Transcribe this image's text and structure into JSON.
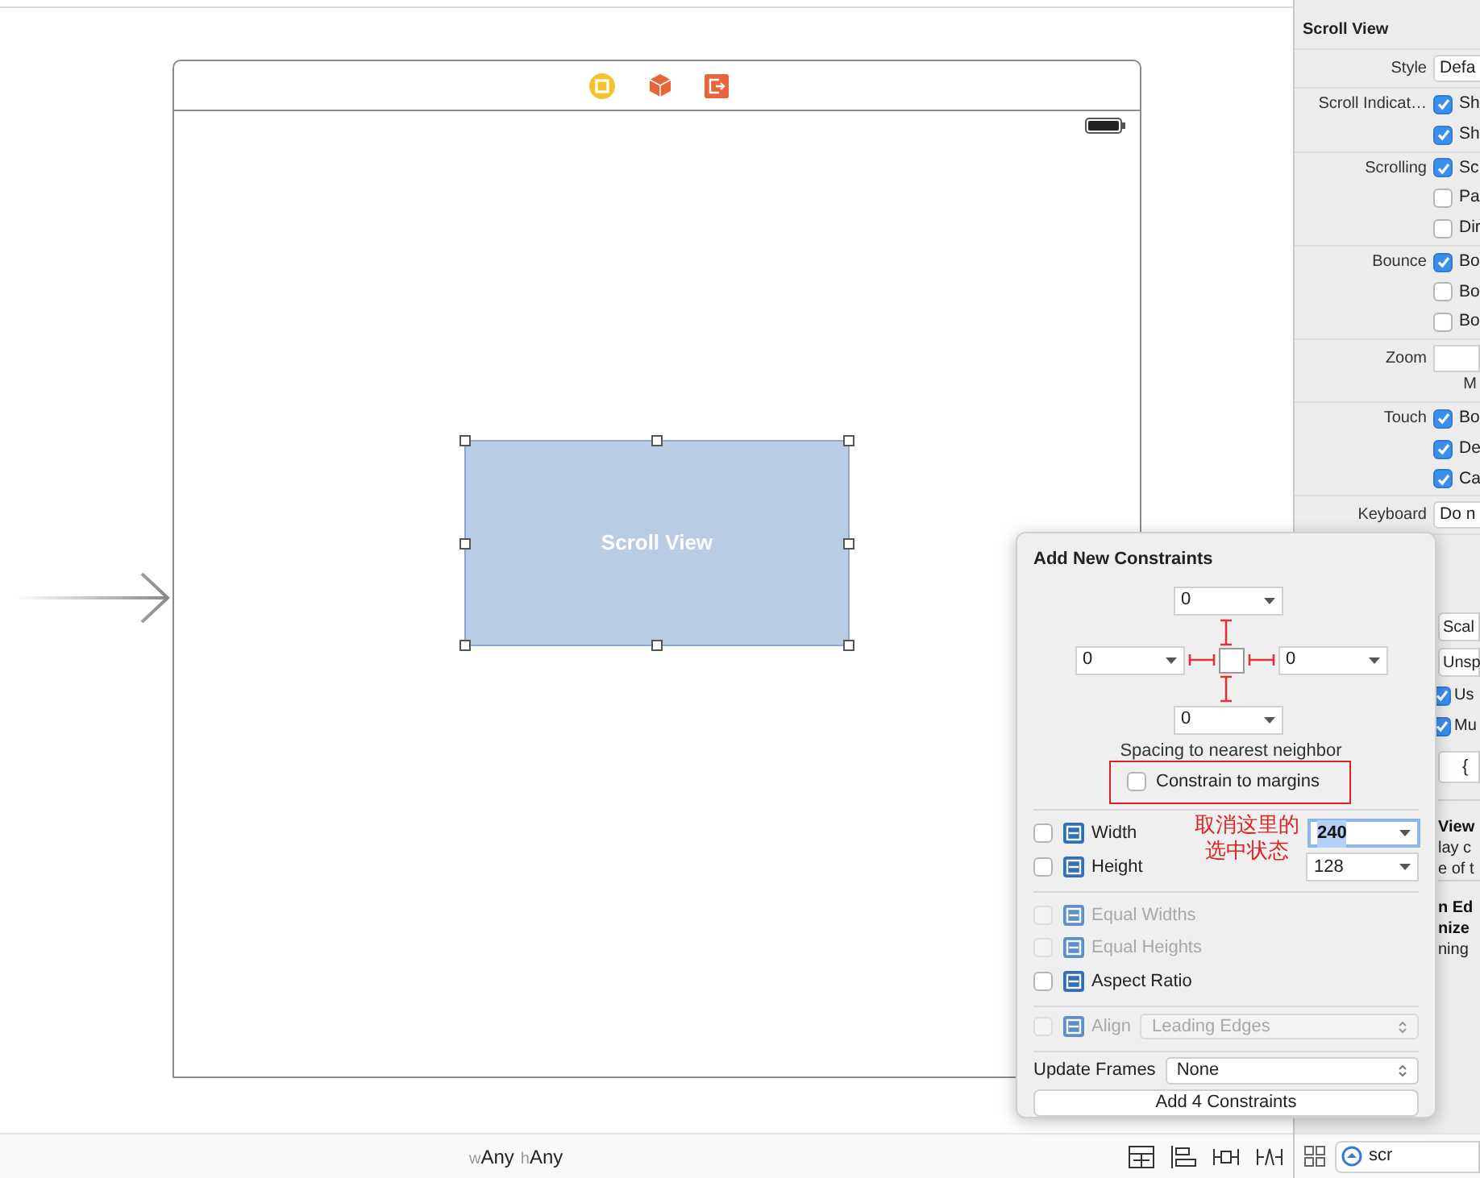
{
  "canvas": {
    "scroll_view_label": "Scroll View"
  },
  "bottom_bar": {
    "size_class": [
      {
        "prefix": "w",
        "value": "Any"
      },
      {
        "prefix": "h",
        "value": "Any"
      }
    ],
    "search_value": "scr"
  },
  "inspector": {
    "title": "Scroll View",
    "rows": [
      {
        "kind": "select",
        "label": "Style",
        "value": "Defa"
      },
      {
        "kind": "checks",
        "label": "Scroll Indicat…",
        "items": [
          {
            "text": "Sh",
            "checked": true
          },
          {
            "text": "Sh",
            "checked": true
          }
        ]
      },
      {
        "kind": "checks",
        "label": "Scrolling",
        "items": [
          {
            "text": "Sc",
            "checked": true
          },
          {
            "text": "Pa",
            "checked": false
          },
          {
            "text": "Dir",
            "checked": false
          }
        ]
      },
      {
        "kind": "checks",
        "label": "Bounce",
        "items": [
          {
            "text": "Bo",
            "checked": true
          },
          {
            "text": "Bo",
            "checked": false
          },
          {
            "text": "Bo",
            "checked": false
          }
        ]
      },
      {
        "kind": "field",
        "label": "Zoom",
        "note": "M"
      },
      {
        "kind": "checks",
        "label": "Touch",
        "items": [
          {
            "text": "Bo",
            "checked": true
          },
          {
            "text": "De",
            "checked": true
          },
          {
            "text": "Ca",
            "checked": true
          }
        ]
      },
      {
        "kind": "select",
        "label": "Keyboard",
        "value": "Do n"
      }
    ],
    "peek": [
      {
        "kind": "select",
        "text": "Scal"
      },
      {
        "kind": "select",
        "text": "Unsp"
      },
      {
        "kind": "check",
        "text": "Us",
        "checked": true
      },
      {
        "kind": "check",
        "text": "Mu",
        "checked": true
      },
      {
        "kind": "button",
        "text": "{"
      },
      {
        "kind": "heading",
        "text": "View"
      },
      {
        "kind": "line",
        "text": "lay c"
      },
      {
        "kind": "line",
        "text": "e of t"
      },
      {
        "kind": "heading",
        "text": "n Ed"
      },
      {
        "kind": "subheading",
        "text": "nize"
      },
      {
        "kind": "line",
        "text": "ning"
      }
    ]
  },
  "popover": {
    "title": "Add New Constraints",
    "spacing": {
      "top": {
        "value": "0",
        "pinned": true
      },
      "left": {
        "value": "0",
        "pinned": true
      },
      "right": {
        "value": "0",
        "pinned": true
      },
      "bottom": {
        "value": "0",
        "pinned": true
      }
    },
    "spacing_caption": "Spacing to nearest neighbor",
    "margins": {
      "label": "Constrain to margins",
      "checked": false
    },
    "annotation": [
      "取消这里的",
      "选中状态"
    ],
    "constraints": [
      {
        "label": "Width",
        "checked": false,
        "disabled": false,
        "value": "240",
        "focused": true
      },
      {
        "label": "Height",
        "checked": false,
        "disabled": false,
        "value": "128",
        "focused": false
      },
      {
        "label": "Equal Widths",
        "checked": false,
        "disabled": true
      },
      {
        "label": "Equal Heights",
        "checked": false,
        "disabled": true
      },
      {
        "label": "Aspect Ratio",
        "checked": false,
        "disabled": false
      }
    ],
    "align": {
      "label": "Align",
      "checked": false,
      "disabled": true,
      "value": "Leading Edges"
    },
    "update_frames": {
      "label": "Update Frames",
      "value": "None"
    },
    "add_button": "Add 4 Constraints"
  }
}
